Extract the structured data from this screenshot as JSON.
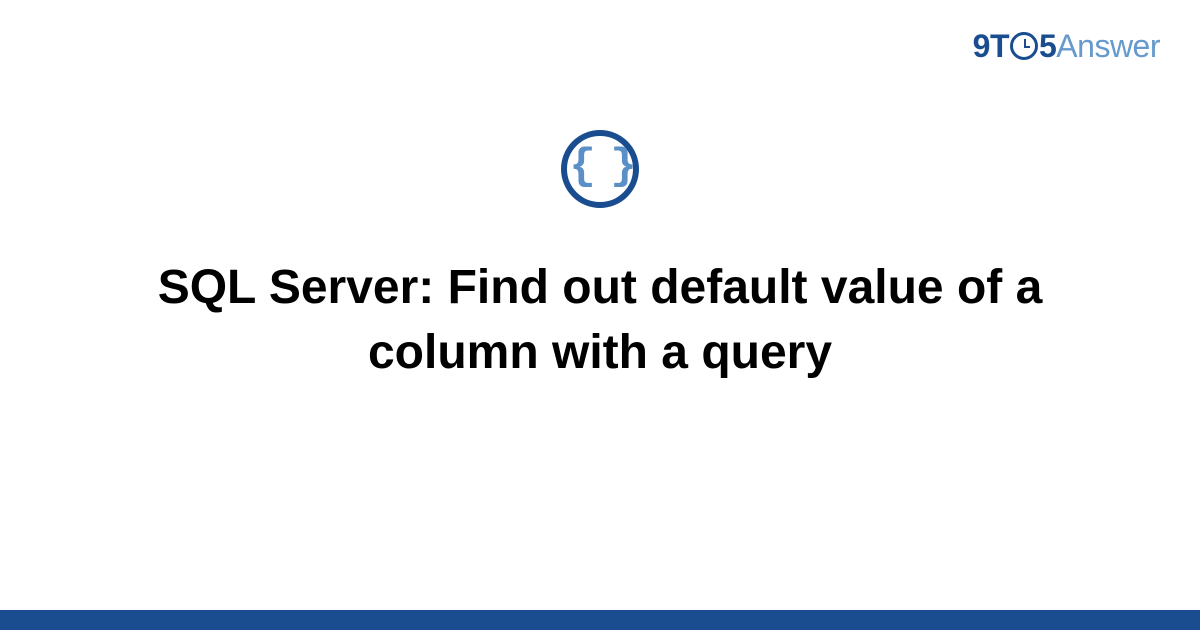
{
  "logo": {
    "nine": "9",
    "t": "T",
    "five": "5",
    "answer": "Answer"
  },
  "icon": {
    "braces": "{ }"
  },
  "title": "SQL Server: Find out default value of a column with a query"
}
